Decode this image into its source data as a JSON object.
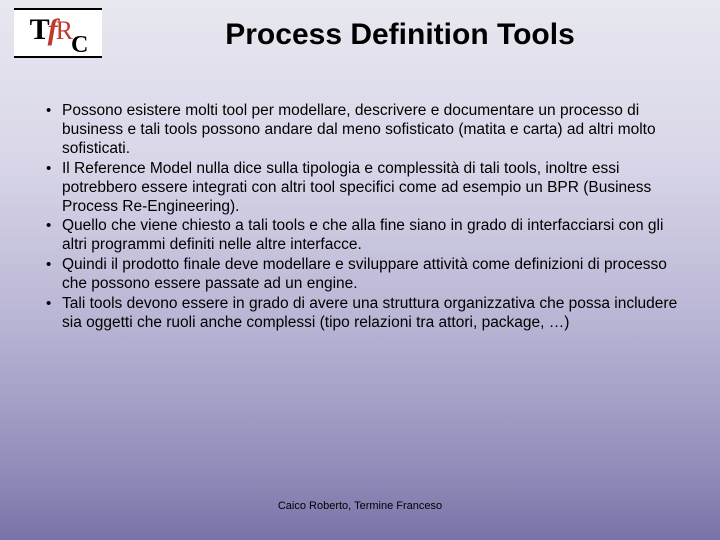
{
  "logo": {
    "t": "T",
    "f": "f",
    "r": "R",
    "c": "C"
  },
  "title": "Process Definition Tools",
  "bullets": [
    "Possono esistere molti tool per modellare, descrivere e documentare un processo di business e tali tools possono andare dal meno sofisticato (matita e carta) ad altri molto sofisticati.",
    "Il Reference Model nulla dice sulla tipologia e complessità di tali tools, inoltre essi potrebbero essere integrati con altri tool specifici come ad esempio un BPR (Business Process Re-Engineering).",
    "Quello che viene chiesto a tali tools e che alla fine siano in grado di interfacciarsi con gli altri programmi definiti nelle altre interfacce.",
    "Quindi il prodotto finale deve modellare e sviluppare attività come definizioni di processo che possono essere passate ad un engine.",
    "Tali tools devono essere in grado di avere una struttura organizzativa che possa  includere sia oggetti che ruoli anche complessi (tipo relazioni tra attori, package, …)"
  ],
  "footer": "Caico Roberto, Termine Franceso"
}
